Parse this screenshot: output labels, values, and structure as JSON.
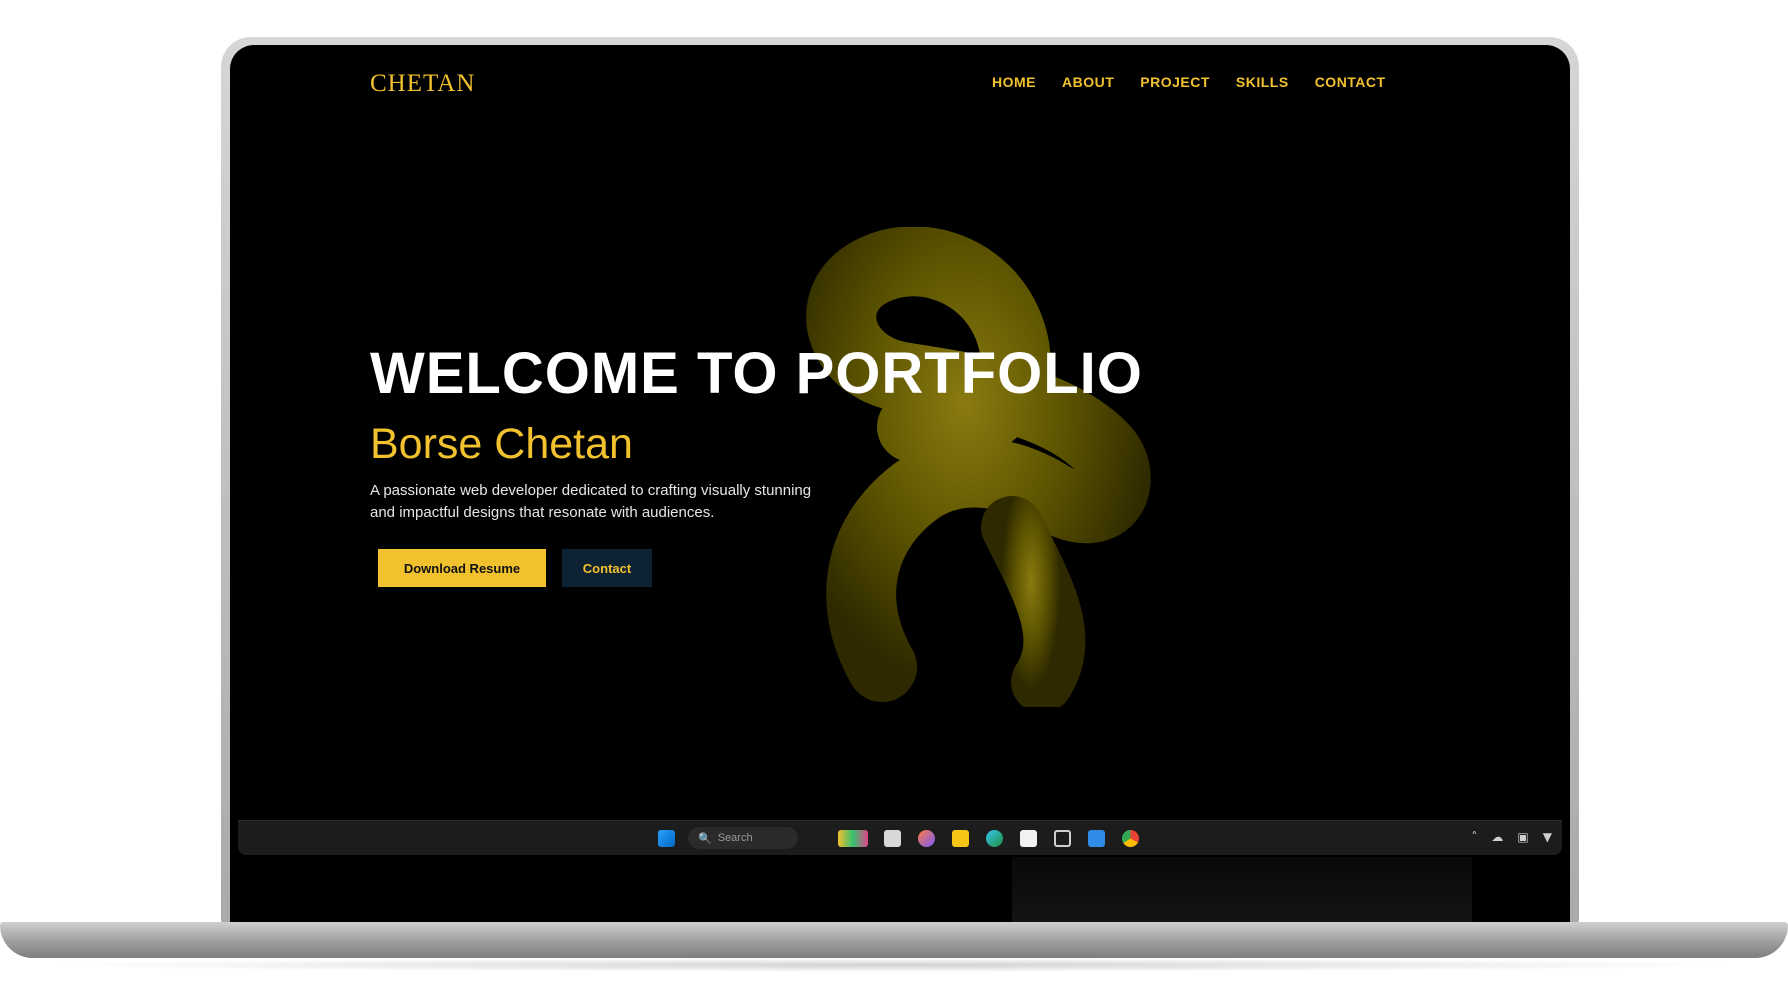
{
  "site": {
    "brand": "CHETAN",
    "nav": [
      "HOME",
      "ABOUT",
      "PROJECT",
      "SKILLS",
      "CONTACT"
    ]
  },
  "hero": {
    "title": "WELCOME TO PORTFOLIO",
    "name": "Borse Chetan",
    "description": "A passionate web developer dedicated to crafting visually stunning and impactful designs that resonate with audiences.",
    "buttons": {
      "download": "Download Resume",
      "contact": "Contact"
    }
  },
  "taskbar": {
    "search_placeholder": "Search",
    "icons": [
      "windows-start-icon",
      "search-icon",
      "widgets-icon",
      "file-icon",
      "copilot-icon",
      "folder-icon",
      "edge-icon",
      "store-icon",
      "snip-icon",
      "vscode-icon",
      "chrome-icon"
    ]
  },
  "colors": {
    "accent": "#f2c12e",
    "background": "#000000",
    "contact_button_bg": "#0d2233"
  }
}
